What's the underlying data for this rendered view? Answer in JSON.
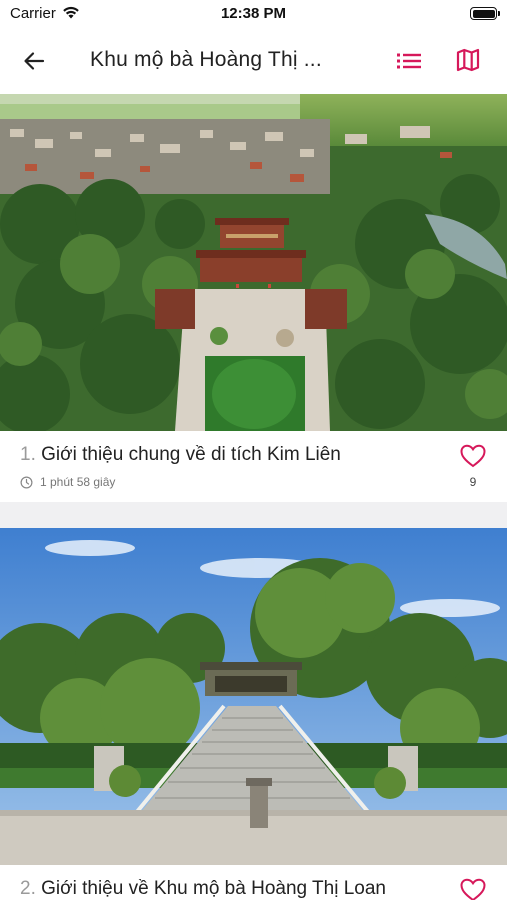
{
  "status_bar": {
    "carrier": "Carrier",
    "time": "12:38 PM",
    "wifi_icon": "wifi-icon",
    "battery_icon": "battery-icon"
  },
  "nav": {
    "back_icon": "arrow-left-icon",
    "title": "Khu mộ bà Hoàng Thị ...",
    "list_icon": "list-icon",
    "map_icon": "map-icon",
    "accent_color": "#d6185a"
  },
  "items": [
    {
      "index": "1.",
      "title": "Giới thiệu chung về di tích Kim Liên",
      "duration": "1 phút 58 giây",
      "likes": "9",
      "image": "aerial view of temple complex among trees and village"
    },
    {
      "index": "2.",
      "title": "Giới thiệu về Khu mộ bà Hoàng Thị Loan",
      "image": "stone stairway leading to tomb under large trees and blue sky"
    }
  ]
}
